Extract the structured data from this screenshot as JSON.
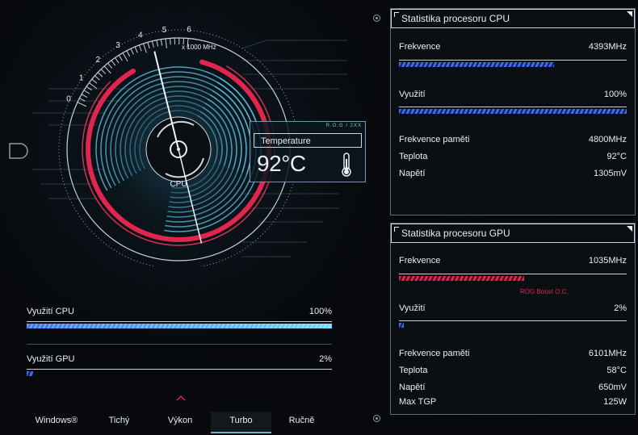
{
  "gauge": {
    "scale_ticks": [
      "0",
      "1",
      "2",
      "3",
      "4",
      "5",
      "6"
    ],
    "unit": "x 1000 MHz",
    "center_label": "CPU",
    "needle_value": 4.393
  },
  "temperature_card": {
    "tag": "R.O.G / 2XX",
    "label": "Temperature",
    "value": "92°C"
  },
  "usage": {
    "cpu": {
      "label": "Využití CPU",
      "value": "100%",
      "percent": 100
    },
    "gpu": {
      "label": "Využití GPU",
      "value": "2%",
      "percent": 2
    }
  },
  "modes": {
    "items": [
      {
        "label": "Windows®",
        "active": false
      },
      {
        "label": "Tichý",
        "active": false
      },
      {
        "label": "Výkon",
        "active": false
      },
      {
        "label": "Turbo",
        "active": true
      },
      {
        "label": "Ručně",
        "active": false
      }
    ]
  },
  "cpu_panel": {
    "title": "Statistika procesoru CPU",
    "freq_label": "Frekvence",
    "freq_value": "4393MHz",
    "freq_percent": 68,
    "usage_label": "Využití",
    "usage_value": "100%",
    "usage_percent": 100,
    "mem_label": "Frekvence paměti",
    "mem_value": "4800MHz",
    "temp_label": "Teplota",
    "temp_value": "92°C",
    "volt_label": "Napětí",
    "volt_value": "1305mV"
  },
  "gpu_panel": {
    "title": "Statistika procesoru GPU",
    "freq_label": "Frekvence",
    "freq_value": "1035MHz",
    "freq_percent": 55,
    "boost_label": "ROG Boost O.C.",
    "usage_label": "Využití",
    "usage_value": "2%",
    "usage_percent": 2,
    "mem_label": "Frekvence paměti",
    "mem_value": "6101MHz",
    "temp_label": "Teplota",
    "temp_value": "58°C",
    "volt_label": "Napětí",
    "volt_value": "650mV",
    "tgp_label": "Max TGP",
    "tgp_value": "125W"
  },
  "colors": {
    "accent_red": "#e0264e",
    "accent_blue": "#3b6cf0",
    "accent_cyan": "#5ec6e6"
  }
}
